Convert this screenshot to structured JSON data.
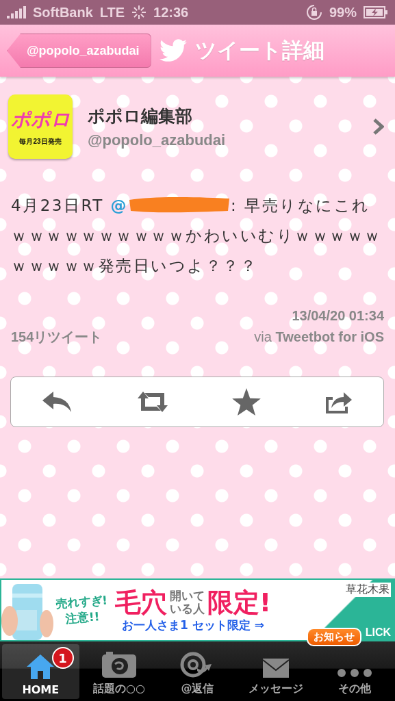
{
  "status_bar": {
    "carrier": "SoftBank",
    "network": "LTE",
    "time": "12:36",
    "battery": "99%"
  },
  "nav_bar": {
    "back": "@popolo_azabudai",
    "title": "ツイート詳細"
  },
  "author": {
    "avatar_text": "ポポロ",
    "avatar_subtext": "毎月23日発売",
    "name": "ポポロ編集部",
    "handle": "@popolo_azabudai"
  },
  "tweet": {
    "prefix": "4月23日RT ",
    "mention": "@",
    "rest": ": 早売りなにこれｗｗｗｗｗｗｗｗｗｗかわいいむりｗｗｗｗｗｗｗｗｗｗ発売日いつよ？？？",
    "timestamp": "13/04/20 01:34",
    "retweets": "154リツイート",
    "via_label": "via",
    "via_app": "Tweetbot for iOS"
  },
  "ad": {
    "tagline_1": "売れすぎ!",
    "tagline_2": "注意!!",
    "headline_1": "毛穴",
    "headline_2a": "開いて",
    "headline_2b": "いる人",
    "headline_3": "限定!",
    "offer": "お一人さま1 セット限定 ⇒",
    "brand": "草花木果",
    "cta": "LICK"
  },
  "tabs": [
    {
      "label": "HOME",
      "kind": "home",
      "selected": true,
      "badge": "1"
    },
    {
      "label": "話題の○○",
      "kind": "camera",
      "selected": false
    },
    {
      "label": "@返信",
      "kind": "at",
      "selected": false
    },
    {
      "label": "メッセージ",
      "kind": "mail",
      "selected": false
    },
    {
      "label": "その他",
      "kind": "more",
      "selected": false,
      "callout": "お知らせ"
    }
  ]
}
